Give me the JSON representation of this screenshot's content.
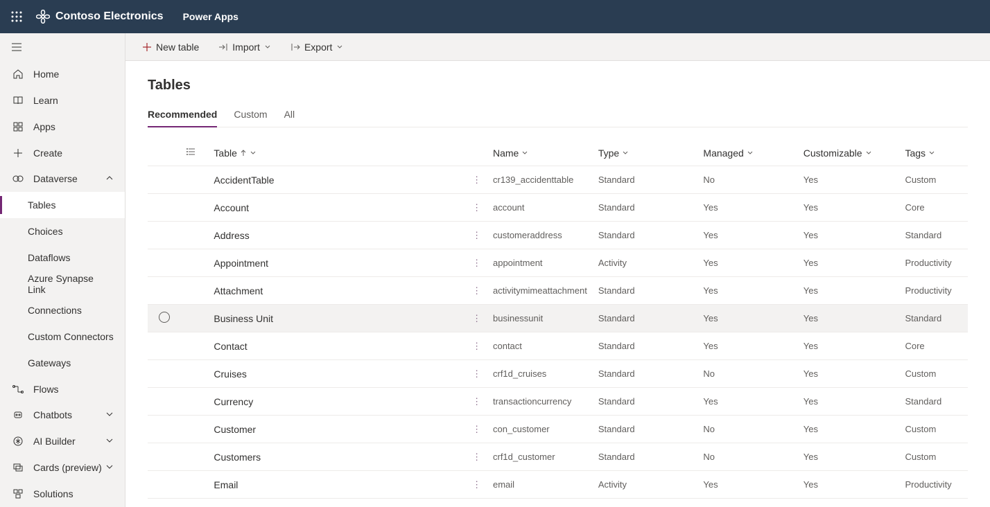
{
  "header": {
    "org": "Contoso Electronics",
    "app": "Power Apps"
  },
  "sidebar": {
    "home": "Home",
    "learn": "Learn",
    "apps": "Apps",
    "create": "Create",
    "dataverse": "Dataverse",
    "tables": "Tables",
    "choices": "Choices",
    "dataflows": "Dataflows",
    "synapse": "Azure Synapse Link",
    "connections": "Connections",
    "custom_conn": "Custom Connectors",
    "gateways": "Gateways",
    "flows": "Flows",
    "chatbots": "Chatbots",
    "ai_builder": "AI Builder",
    "cards": "Cards (preview)",
    "solutions": "Solutions"
  },
  "toolbar": {
    "new_table": "New table",
    "import": "Import",
    "export": "Export"
  },
  "page": {
    "title": "Tables",
    "tabs": {
      "recommended": "Recommended",
      "custom": "Custom",
      "all": "All"
    }
  },
  "columns": {
    "table": "Table",
    "name": "Name",
    "type": "Type",
    "managed": "Managed",
    "customizable": "Customizable",
    "tags": "Tags"
  },
  "rows": [
    {
      "table": "AccidentTable",
      "name": "cr139_accidenttable",
      "type": "Standard",
      "managed": "No",
      "customizable": "Yes",
      "tags": "Custom"
    },
    {
      "table": "Account",
      "name": "account",
      "type": "Standard",
      "managed": "Yes",
      "customizable": "Yes",
      "tags": "Core"
    },
    {
      "table": "Address",
      "name": "customeraddress",
      "type": "Standard",
      "managed": "Yes",
      "customizable": "Yes",
      "tags": "Standard"
    },
    {
      "table": "Appointment",
      "name": "appointment",
      "type": "Activity",
      "managed": "Yes",
      "customizable": "Yes",
      "tags": "Productivity"
    },
    {
      "table": "Attachment",
      "name": "activitymimeattachment",
      "type": "Standard",
      "managed": "Yes",
      "customizable": "Yes",
      "tags": "Productivity"
    },
    {
      "table": "Business Unit",
      "name": "businessunit",
      "type": "Standard",
      "managed": "Yes",
      "customizable": "Yes",
      "tags": "Standard",
      "hovered": true
    },
    {
      "table": "Contact",
      "name": "contact",
      "type": "Standard",
      "managed": "Yes",
      "customizable": "Yes",
      "tags": "Core"
    },
    {
      "table": "Cruises",
      "name": "crf1d_cruises",
      "type": "Standard",
      "managed": "No",
      "customizable": "Yes",
      "tags": "Custom"
    },
    {
      "table": "Currency",
      "name": "transactioncurrency",
      "type": "Standard",
      "managed": "Yes",
      "customizable": "Yes",
      "tags": "Standard"
    },
    {
      "table": "Customer",
      "name": "con_customer",
      "type": "Standard",
      "managed": "No",
      "customizable": "Yes",
      "tags": "Custom"
    },
    {
      "table": "Customers",
      "name": "crf1d_customer",
      "type": "Standard",
      "managed": "No",
      "customizable": "Yes",
      "tags": "Custom"
    },
    {
      "table": "Email",
      "name": "email",
      "type": "Activity",
      "managed": "Yes",
      "customizable": "Yes",
      "tags": "Productivity"
    }
  ]
}
